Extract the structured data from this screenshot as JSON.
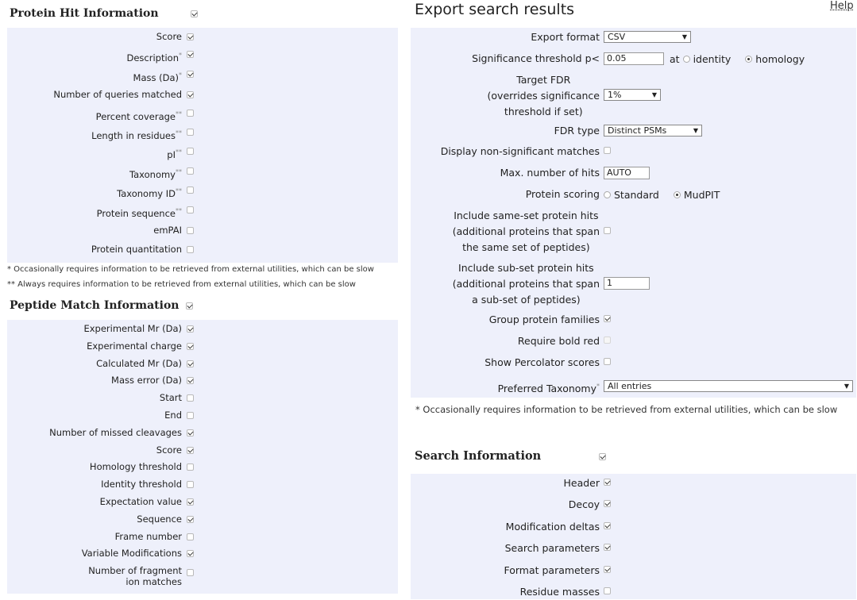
{
  "protein_hit": {
    "title": "Protein Hit Information",
    "checked": true,
    "rows": [
      {
        "label": "Score",
        "mark": "",
        "checked": true
      },
      {
        "label": "Description",
        "mark": "*",
        "checked": true
      },
      {
        "label": "Mass (Da)",
        "mark": "*",
        "checked": true
      },
      {
        "label": "Number of queries matched",
        "mark": "",
        "checked": true
      },
      {
        "label": "Percent coverage",
        "mark": "**",
        "checked": false
      },
      {
        "label": "Length in residues",
        "mark": "**",
        "checked": false
      },
      {
        "label": "pI",
        "mark": "**",
        "checked": false
      },
      {
        "label": "Taxonomy",
        "mark": "**",
        "checked": false
      },
      {
        "label": "Taxonomy ID",
        "mark": "**",
        "checked": false
      },
      {
        "label": "Protein sequence",
        "mark": "**",
        "checked": false
      },
      {
        "label": "emPAI",
        "mark": "",
        "checked": false
      },
      {
        "label": "Protein quantitation",
        "mark": "",
        "checked": false
      }
    ],
    "note1": "* Occasionally requires information to be retrieved from external utilities, which can be slow",
    "note2": "** Always requires information to be retrieved from external utilities, which can be slow"
  },
  "peptide_match": {
    "title": "Peptide Match Information",
    "checked": true,
    "rows": [
      {
        "label": "Experimental Mr (Da)",
        "checked": true
      },
      {
        "label": "Experimental charge",
        "checked": true
      },
      {
        "label": "Calculated Mr (Da)",
        "checked": true
      },
      {
        "label": "Mass error (Da)",
        "checked": true
      },
      {
        "label": "Start",
        "checked": false
      },
      {
        "label": "End",
        "checked": false
      },
      {
        "label": "Number of missed cleavages",
        "checked": true
      },
      {
        "label": "Score",
        "checked": true
      },
      {
        "label": "Homology threshold",
        "checked": false
      },
      {
        "label": "Identity threshold",
        "checked": false
      },
      {
        "label": "Expectation value",
        "checked": true
      },
      {
        "label": "Sequence",
        "checked": true
      },
      {
        "label": "Frame number",
        "checked": false
      },
      {
        "label": "Variable Modifications",
        "checked": true
      },
      {
        "label": "Number of fragment\nion matches",
        "checked": false
      }
    ]
  },
  "export": {
    "title": "Export search results",
    "help": "Help",
    "export_format_label": "Export format",
    "export_format_value": "CSV",
    "significance_label": "Significance threshold p<",
    "significance_value": "0.05",
    "at_label": "at",
    "identity_label": "identity",
    "homology_label": "homology",
    "target_fdr_label": "Target FDR\n(overrides significance\nthreshold if set)",
    "target_fdr_value": "1%",
    "fdr_type_label": "FDR type",
    "fdr_type_value": "Distinct PSMs",
    "display_nonsig_label": "Display non-significant matches",
    "max_hits_label": "Max. number of hits",
    "max_hits_value": "AUTO",
    "protein_scoring_label": "Protein scoring",
    "standard_label": "Standard",
    "mudpit_label": "MudPIT",
    "same_set_label": "Include same-set protein hits\n(additional proteins that span\nthe same set of peptides)",
    "sub_set_label": "Include sub-set protein hits\n(additional proteins that span\na sub-set of peptides)",
    "sub_set_value": "1",
    "group_families_label": "Group protein families",
    "bold_red_label": "Require bold red",
    "percolator_label": "Show Percolator scores",
    "pref_tax_label": "Preferred Taxonomy",
    "pref_tax_mark": "*",
    "pref_tax_value": "All entries",
    "note": "* Occasionally requires information to be retrieved from external utilities, which can be slow"
  },
  "search_info": {
    "title": "Search Information",
    "checked": true,
    "rows": [
      {
        "label": "Header",
        "checked": true
      },
      {
        "label": "Decoy",
        "checked": true
      },
      {
        "label": "Modification deltas",
        "checked": true
      },
      {
        "label": "Search parameters",
        "checked": true
      },
      {
        "label": "Format parameters",
        "checked": true
      },
      {
        "label": "Residue masses",
        "checked": false
      }
    ]
  }
}
